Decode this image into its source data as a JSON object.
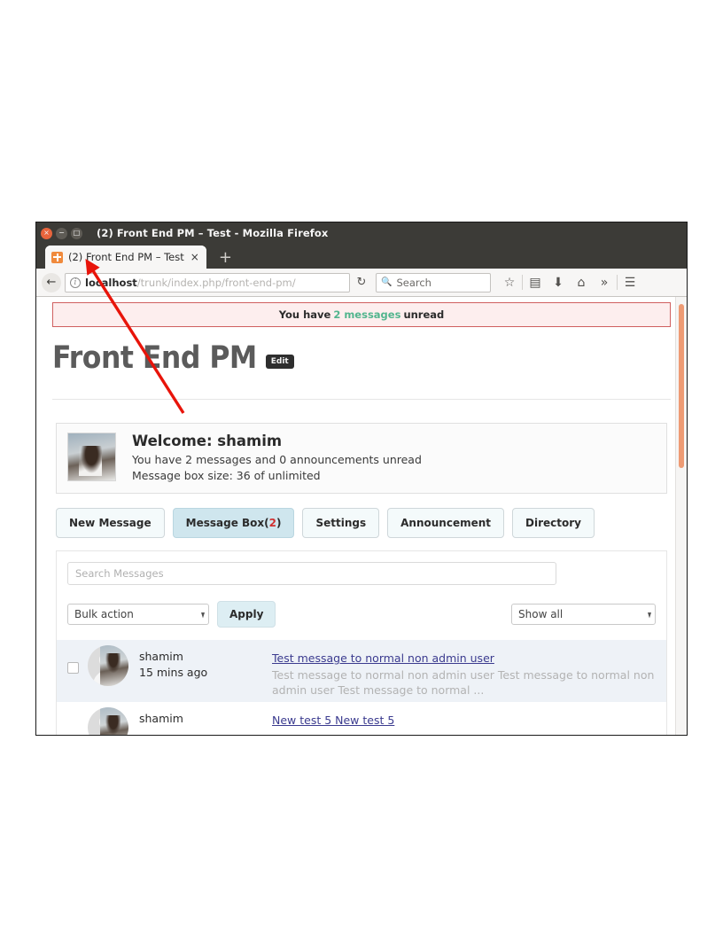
{
  "window": {
    "title": "(2) Front End PM – Test - Mozilla Firefox",
    "close_glyph": "×",
    "minimize_glyph": "−",
    "maximize_glyph": "□"
  },
  "tabbar": {
    "tab_label": "(2) Front End PM – Test",
    "tab_close_glyph": "×",
    "new_tab_glyph": "+"
  },
  "toolbar": {
    "back_glyph": "←",
    "info_glyph": "i",
    "url_host": "localhost",
    "url_path": "/trunk/index.php/front-end-pm/",
    "reload_glyph": "↻",
    "search_icon_glyph": "🔍",
    "search_placeholder": "Search",
    "bookmark_glyph": "☆",
    "library_glyph": "▤",
    "download_glyph": "⬇",
    "home_glyph": "⌂",
    "overflow_glyph": "»",
    "menu_glyph": "☰"
  },
  "notice": {
    "prefix": "You have",
    "count_text": "2 messages",
    "suffix": "unread",
    "count_color": "#52b58e",
    "bg_color": "#fdeeee",
    "border_color": "#d06060"
  },
  "header": {
    "site_title": "Front End PM",
    "edit_badge": "Edit"
  },
  "welcome": {
    "heading": "Welcome: shamim",
    "line1": "You have 2 messages and 0 announcements unread",
    "line2": "Message box size: 36 of unlimited"
  },
  "tabs": [
    {
      "label": "New Message",
      "active": false
    },
    {
      "label": "Message Box(",
      "count": "2",
      "suffix": ")",
      "active": true
    },
    {
      "label": "Settings",
      "active": false
    },
    {
      "label": "Announcement",
      "active": false
    },
    {
      "label": "Directory",
      "active": false
    }
  ],
  "tabs_active_bg": "#cfe6ee",
  "search": {
    "placeholder": "Search Messages",
    "value": ""
  },
  "controls": {
    "bulk_action_value": "Bulk action",
    "apply_label": "Apply",
    "show_filter_value": "Show all",
    "select_arrow_glyph": "▾"
  },
  "messages": [
    {
      "sender": "shamim",
      "time": "15 mins ago",
      "subject": "Test message to normal non admin user",
      "excerpt": "Test message to normal non admin user Test message to normal non admin user Test message to normal ...",
      "unread": true
    },
    {
      "sender": "shamim",
      "time": "",
      "subject": "New test 5 New test 5",
      "excerpt": "",
      "unread": false
    }
  ],
  "scrollbar": {
    "thumb_color": "#ee9b74"
  },
  "annotation": {
    "arrow_color": "#e8140a"
  }
}
